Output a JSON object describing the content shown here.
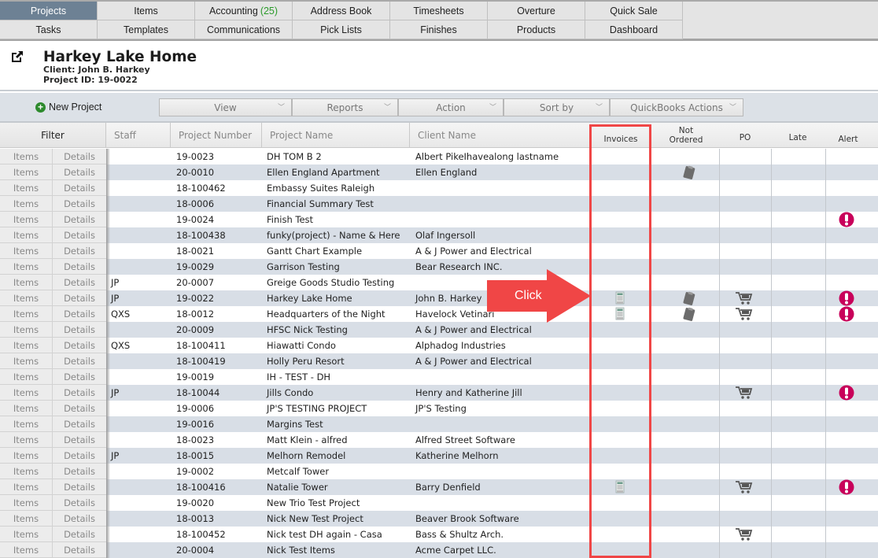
{
  "nav": {
    "row1": [
      {
        "label": "Projects",
        "active": true
      },
      {
        "label": "Items"
      },
      {
        "label": "Accounting",
        "count": "(25)"
      },
      {
        "label": "Address Book"
      },
      {
        "label": "Timesheets"
      },
      {
        "label": "Overture"
      },
      {
        "label": "Quick Sale"
      }
    ],
    "row2": [
      {
        "label": "Tasks"
      },
      {
        "label": "Templates"
      },
      {
        "label": "Communications"
      },
      {
        "label": "Pick Lists"
      },
      {
        "label": "Finishes"
      },
      {
        "label": "Products"
      },
      {
        "label": "Dashboard"
      }
    ]
  },
  "project": {
    "title": "Harkey Lake Home",
    "client": "Client: John B. Harkey",
    "project_id": "Project ID: 19-0022"
  },
  "toolbar": {
    "new_project": "New Project",
    "dropdowns": [
      "View",
      "Reports",
      "Action",
      "Sort by",
      "QuickBooks Actions"
    ]
  },
  "columns": {
    "filter": "Filter",
    "staff": "Staff",
    "project_number": "Project Number",
    "project_name": "Project Name",
    "client_name": "Client Name",
    "invoices": "Invoices",
    "not_ordered_1": "Not",
    "not_ordered_2": "Ordered",
    "po": "PO",
    "late": "Late",
    "alert": "Alert"
  },
  "row_links": {
    "items": "Items",
    "details": "Details"
  },
  "rows": [
    {
      "staff": "",
      "number": "19-0023",
      "name": "DH TOM B 2",
      "client": "Albert PikeIhavealong lastname",
      "invoice": false,
      "not_ordered": false,
      "po": false,
      "alert": false
    },
    {
      "staff": "",
      "number": "20-0010",
      "name": "Ellen England Apartment",
      "client": "Ellen England",
      "invoice": false,
      "not_ordered": true,
      "po": false,
      "alert": false
    },
    {
      "staff": "",
      "number": "18-100462",
      "name": "Embassy Suites Raleigh",
      "client": "",
      "invoice": false,
      "not_ordered": false,
      "po": false,
      "alert": false
    },
    {
      "staff": "",
      "number": "18-0006",
      "name": "Financial Summary Test",
      "client": "",
      "invoice": false,
      "not_ordered": false,
      "po": false,
      "alert": false
    },
    {
      "staff": "",
      "number": "19-0024",
      "name": "Finish Test",
      "client": "",
      "invoice": false,
      "not_ordered": false,
      "po": false,
      "alert": true
    },
    {
      "staff": "",
      "number": "18-100438",
      "name": "funky(project) - Name & Here",
      "client": "Olaf Ingersoll",
      "invoice": false,
      "not_ordered": false,
      "po": false,
      "alert": false
    },
    {
      "staff": "",
      "number": "18-0021",
      "name": "Gantt Chart Example",
      "client": "A & J Power and Electrical",
      "invoice": false,
      "not_ordered": false,
      "po": false,
      "alert": false
    },
    {
      "staff": "",
      "number": "19-0029",
      "name": "Garrison Testing",
      "client": "Bear Research INC.",
      "invoice": false,
      "not_ordered": false,
      "po": false,
      "alert": false
    },
    {
      "staff": "JP",
      "number": "20-0007",
      "name": "Greige Goods Studio Testing",
      "client": "",
      "invoice": false,
      "not_ordered": false,
      "po": false,
      "alert": false
    },
    {
      "staff": "JP",
      "number": "19-0022",
      "name": "Harkey Lake Home",
      "client": "John B. Harkey",
      "invoice": true,
      "not_ordered": true,
      "po": true,
      "alert": true
    },
    {
      "staff": "QXS",
      "number": "18-0012",
      "name": "Headquarters of the Night",
      "client": "Havelock Vetinari",
      "invoice": true,
      "not_ordered": true,
      "po": true,
      "alert": true
    },
    {
      "staff": "",
      "number": "20-0009",
      "name": "HFSC Nick Testing",
      "client": "A & J Power and Electrical",
      "invoice": false,
      "not_ordered": false,
      "po": false,
      "alert": false
    },
    {
      "staff": "QXS",
      "number": "18-100411",
      "name": "Hiawatti Condo",
      "client": "Alphadog Industries",
      "invoice": false,
      "not_ordered": false,
      "po": false,
      "alert": false
    },
    {
      "staff": "",
      "number": "18-100419",
      "name": "Holly Peru Resort",
      "client": "A & J Power and Electrical",
      "invoice": false,
      "not_ordered": false,
      "po": false,
      "alert": false
    },
    {
      "staff": "",
      "number": "19-0019",
      "name": "IH - TEST - DH",
      "client": "",
      "invoice": false,
      "not_ordered": false,
      "po": false,
      "alert": false
    },
    {
      "staff": "JP",
      "number": "18-10044",
      "name": "Jills Condo",
      "client": "Henry and Katherine Jill",
      "invoice": false,
      "not_ordered": false,
      "po": true,
      "alert": true
    },
    {
      "staff": "",
      "number": "19-0006",
      "name": "JP'S TESTING PROJECT",
      "client": "JP'S Testing",
      "invoice": false,
      "not_ordered": false,
      "po": false,
      "alert": false
    },
    {
      "staff": "",
      "number": "19-0016",
      "name": "Margins Test",
      "client": "",
      "invoice": false,
      "not_ordered": false,
      "po": false,
      "alert": false
    },
    {
      "staff": "",
      "number": "18-0023",
      "name": "Matt Klein - alfred",
      "client": "Alfred Street Software",
      "invoice": false,
      "not_ordered": false,
      "po": false,
      "alert": false
    },
    {
      "staff": "JP",
      "number": "18-0015",
      "name": "Melhorn Remodel",
      "client": "Katherine Melhorn",
      "invoice": false,
      "not_ordered": false,
      "po": false,
      "alert": false
    },
    {
      "staff": "",
      "number": "19-0002",
      "name": "Metcalf Tower",
      "client": "",
      "invoice": false,
      "not_ordered": false,
      "po": false,
      "alert": false
    },
    {
      "staff": "",
      "number": "18-100416",
      "name": "Natalie Tower",
      "client": "Barry Denfield",
      "invoice": true,
      "not_ordered": false,
      "po": true,
      "alert": true
    },
    {
      "staff": "",
      "number": "19-0020",
      "name": "New Trio Test Project",
      "client": "",
      "invoice": false,
      "not_ordered": false,
      "po": false,
      "alert": false
    },
    {
      "staff": "",
      "number": "18-0013",
      "name": "Nick New Test Project",
      "client": "Beaver Brook Software",
      "invoice": false,
      "not_ordered": false,
      "po": false,
      "alert": false
    },
    {
      "staff": "",
      "number": "18-100452",
      "name": "Nick test DH again - Casa",
      "client": "Bass & Shultz Arch.",
      "invoice": false,
      "not_ordered": false,
      "po": true,
      "alert": false
    },
    {
      "staff": "",
      "number": "20-0004",
      "name": "Nick Test Items",
      "client": "Acme Carpet LLC.",
      "invoice": false,
      "not_ordered": false,
      "po": false,
      "alert": false
    }
  ],
  "annotation": {
    "label": "Click",
    "color": "#f04646"
  },
  "colors": {
    "active_tab": "#6d8194",
    "row_alt": "#d8dee6",
    "alert": "#c8005a",
    "count": "#2a9a2a"
  }
}
